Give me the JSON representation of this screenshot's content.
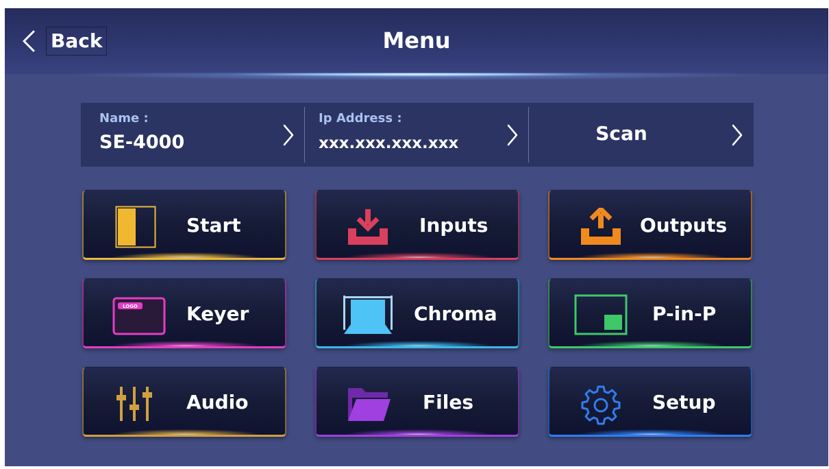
{
  "header": {
    "back_label": "Back",
    "title": "Menu"
  },
  "info_bar": {
    "name_label": "Name :",
    "name_value": "SE-4000",
    "ip_label": "Ip Address :",
    "ip_value": "xxx.xxx.xxx.xxx",
    "scan_label": "Scan"
  },
  "tiles": [
    {
      "label": "Start",
      "icon": "start-icon",
      "accent": "#e8b93a"
    },
    {
      "label": "Inputs",
      "icon": "inputs-icon",
      "accent": "#d9405e"
    },
    {
      "label": "Outputs",
      "icon": "outputs-icon",
      "accent": "#f08a1e"
    },
    {
      "label": "Keyer",
      "icon": "keyer-icon",
      "accent": "#e33dc4"
    },
    {
      "label": "Chroma",
      "icon": "chroma-icon",
      "accent": "#3bb8e8"
    },
    {
      "label": "P-in-P",
      "icon": "pip-icon",
      "accent": "#3ec86a"
    },
    {
      "label": "Audio",
      "icon": "audio-icon",
      "accent": "#d0a040"
    },
    {
      "label": "Files",
      "icon": "files-icon",
      "accent": "#a040e0"
    },
    {
      "label": "Setup",
      "icon": "setup-icon",
      "accent": "#2f7ef0"
    }
  ],
  "keyer_icon_text": "LOGO"
}
